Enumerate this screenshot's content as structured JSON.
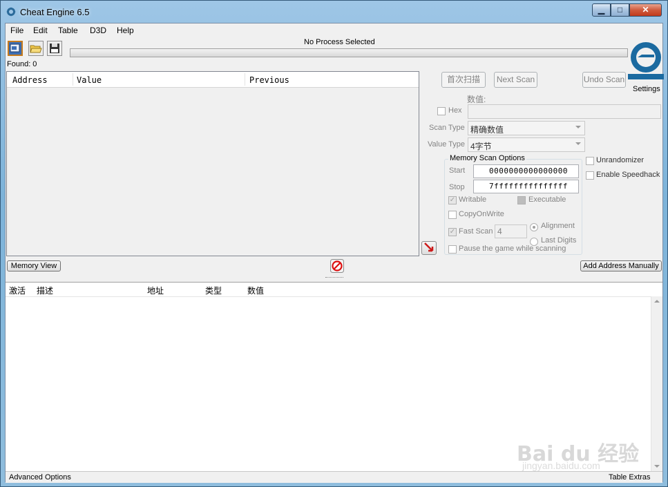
{
  "window": {
    "title": "Cheat Engine 6.5"
  },
  "menu": [
    "File",
    "Edit",
    "Table",
    "D3D",
    "Help"
  ],
  "toolbar": {
    "process_label": "No Process Selected",
    "found": "Found: 0",
    "settings": "Settings"
  },
  "results": {
    "columns": [
      "Address",
      "Value",
      "Previous"
    ]
  },
  "scan": {
    "first_scan": "首次扫描",
    "next_scan": "Next Scan",
    "undo_scan": "Undo Scan",
    "value_label": "数值:",
    "hex_label": "Hex",
    "value": "",
    "scan_type_label": "Scan Type",
    "scan_type": "精确数值",
    "value_type_label": "Value Type",
    "value_type": "4字节",
    "unrandomizer": "Unrandomizer",
    "speedhack": "Enable Speedhack"
  },
  "memory_options": {
    "title": "Memory Scan Options",
    "start_label": "Start",
    "start": "0000000000000000",
    "stop_label": "Stop",
    "stop": "7fffffffffffffff",
    "writable": "Writable",
    "executable": "Executable",
    "copy_on_write": "CopyOnWrite",
    "fast_scan": "Fast Scan",
    "fast_scan_value": "4",
    "alignment": "Alignment",
    "last_digits": "Last Digits",
    "pause": "Pause the game while scanning"
  },
  "buttons": {
    "memory_view": "Memory View",
    "add_address": "Add Address Manually"
  },
  "address_list": {
    "columns": [
      "激活",
      "描述",
      "地址",
      "类型",
      "数值"
    ]
  },
  "status": {
    "left": "Advanced Options",
    "right": "Table Extras"
  },
  "watermark": {
    "main": "Bai du 经验",
    "sub": "jingyan.baidu.com"
  },
  "icons": [
    "cheat-engine-icon",
    "process-select-icon",
    "open-folder-icon",
    "save-icon",
    "pointer-arrow-icon",
    "stop-icon",
    "cheat-engine-logo"
  ]
}
